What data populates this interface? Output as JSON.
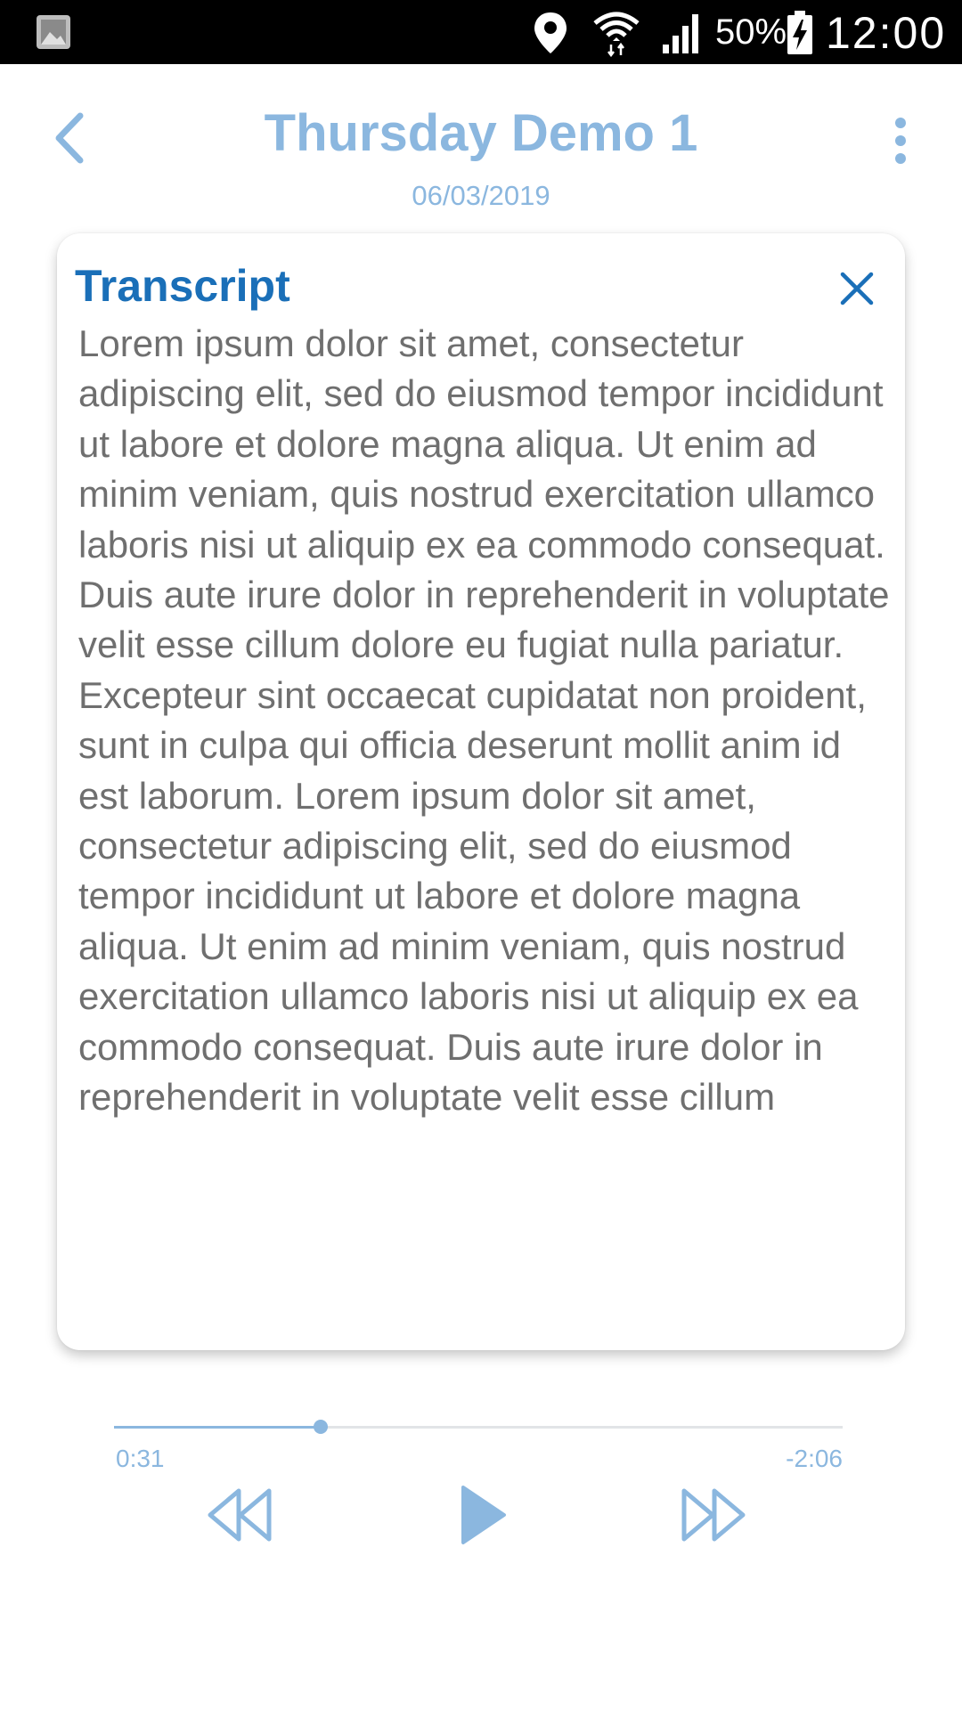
{
  "status_bar": {
    "battery_percent": "50%",
    "time": "12:00",
    "icons": [
      "gallery-icon",
      "location-icon",
      "wifi-icon",
      "signal-icon",
      "battery-charging-icon"
    ]
  },
  "header": {
    "title": "Thursday Demo 1",
    "date": "06/03/2019"
  },
  "transcript": {
    "title": "Transcript",
    "text": "Lorem ipsum dolor sit amet, consectetur adipiscing elit, sed do eiusmod tempor incididunt ut labore et dolore magna aliqua. Ut enim ad minim veniam, quis nostrud exercitation ullamco laboris nisi ut aliquip ex ea commodo consequat. Duis aute irure dolor in reprehenderit in voluptate velit esse cillum dolore eu fugiat nulla pariatur. Excepteur sint occaecat cupidatat non proident, sunt in culpa qui officia deserunt mollit anim id est laborum. Lorem ipsum dolor sit amet, consectetur adipiscing elit, sed do eiusmod tempor incididunt ut labore et dolore magna aliqua. Ut enim ad minim veniam, quis nostrud exercitation ullamco laboris nisi ut aliquip ex ea commodo consequat. Duis aute irure dolor in reprehenderit in voluptate velit esse cillum"
  },
  "player": {
    "elapsed": "0:31",
    "remaining": "-2:06",
    "progress_fraction": 0.284
  },
  "colors": {
    "accent": "#8bb7df",
    "title_blue": "#1a6fb8",
    "body_text": "#6f6f6f"
  }
}
